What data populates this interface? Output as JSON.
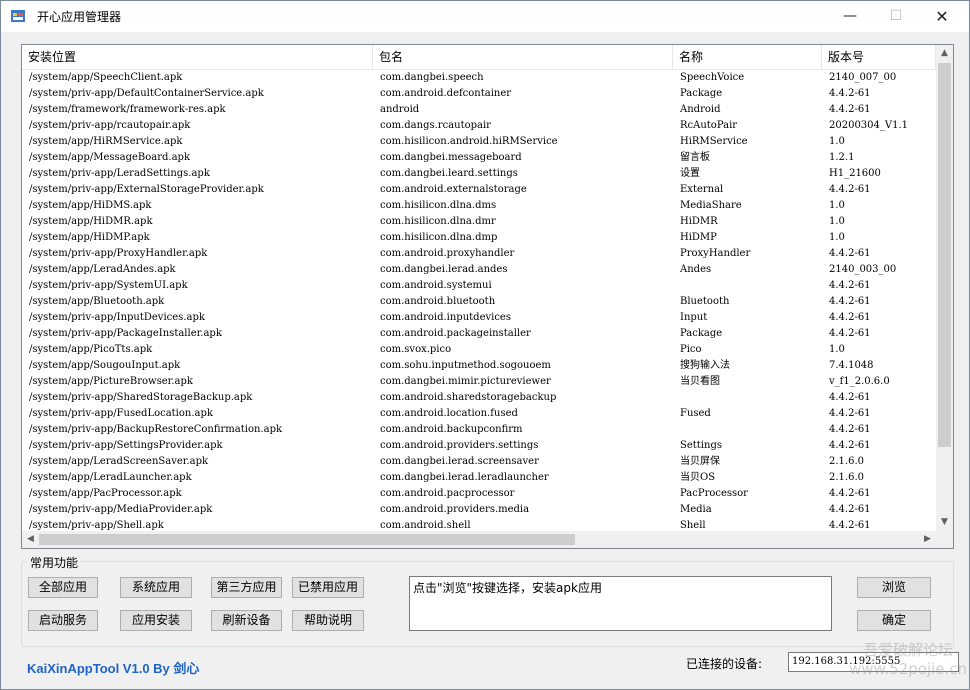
{
  "window": {
    "title": "开心应用管理器",
    "minimize": "—",
    "maximize": "☐",
    "close": "✕"
  },
  "columns": [
    "安装位置",
    "包名",
    "名称",
    "版本号"
  ],
  "rows": [
    [
      "/system/app/SpeechClient.apk",
      "com.dangbei.speech",
      "SpeechVoice",
      "2140_007_00"
    ],
    [
      "/system/priv-app/DefaultContainerService.apk",
      "com.android.defcontainer",
      "Package",
      "4.4.2-61"
    ],
    [
      "/system/framework/framework-res.apk",
      "android",
      "Android",
      "4.4.2-61"
    ],
    [
      "/system/priv-app/rcautopair.apk",
      "com.dangs.rcautopair",
      "RcAutoPair",
      "20200304_V1.1"
    ],
    [
      "/system/app/HiRMService.apk",
      "com.hisilicon.android.hiRMService",
      "HiRMService",
      "1.0"
    ],
    [
      "/system/app/MessageBoard.apk",
      "com.dangbei.messageboard",
      "留言板",
      "1.2.1"
    ],
    [
      "/system/priv-app/LeradSettings.apk",
      "com.dangbei.leard.settings",
      "设置",
      "H1_21600"
    ],
    [
      "/system/priv-app/ExternalStorageProvider.apk",
      "com.android.externalstorage",
      "External",
      "4.4.2-61"
    ],
    [
      "/system/app/HiDMS.apk",
      "com.hisilicon.dlna.dms",
      "MediaShare",
      "1.0"
    ],
    [
      "/system/app/HiDMR.apk",
      "com.hisilicon.dlna.dmr",
      "HiDMR",
      "1.0"
    ],
    [
      "/system/app/HiDMP.apk",
      "com.hisilicon.dlna.dmp",
      "HiDMP",
      "1.0"
    ],
    [
      "/system/priv-app/ProxyHandler.apk",
      "com.android.proxyhandler",
      "ProxyHandler",
      "4.4.2-61"
    ],
    [
      "/system/app/LeradAndes.apk",
      "com.dangbei.lerad.andes",
      "Andes",
      "2140_003_00"
    ],
    [
      "/system/priv-app/SystemUI.apk",
      "com.android.systemui",
      "",
      "4.4.2-61"
    ],
    [
      "/system/app/Bluetooth.apk",
      "com.android.bluetooth",
      "Bluetooth",
      "4.4.2-61"
    ],
    [
      "/system/priv-app/InputDevices.apk",
      "com.android.inputdevices",
      "Input",
      "4.4.2-61"
    ],
    [
      "/system/priv-app/PackageInstaller.apk",
      "com.android.packageinstaller",
      "Package",
      "4.4.2-61"
    ],
    [
      "/system/app/PicoTts.apk",
      "com.svox.pico",
      "Pico",
      "1.0"
    ],
    [
      "/system/app/SougouInput.apk",
      "com.sohu.inputmethod.sogouoem",
      "搜狗输入法",
      "7.4.1048"
    ],
    [
      "/system/app/PictureBrowser.apk",
      "com.dangbei.mimir.pictureviewer",
      "当贝看图",
      "v_f1_2.0.6.0"
    ],
    [
      "/system/priv-app/SharedStorageBackup.apk",
      "com.android.sharedstoragebackup",
      "",
      "4.4.2-61"
    ],
    [
      "/system/priv-app/FusedLocation.apk",
      "com.android.location.fused",
      "Fused",
      "4.4.2-61"
    ],
    [
      "/system/priv-app/BackupRestoreConfirmation.apk",
      "com.android.backupconfirm",
      "",
      "4.4.2-61"
    ],
    [
      "/system/priv-app/SettingsProvider.apk",
      "com.android.providers.settings",
      "Settings",
      "4.4.2-61"
    ],
    [
      "/system/app/LeradScreenSaver.apk",
      "com.dangbei.lerad.screensaver",
      "当贝屏保",
      "2.1.6.0"
    ],
    [
      "/system/app/LeradLauncher.apk",
      "com.dangbei.lerad.leradlauncher",
      "当贝OS",
      "2.1.6.0"
    ],
    [
      "/system/app/PacProcessor.apk",
      "com.android.pacprocessor",
      "PacProcessor",
      "4.4.2-61"
    ],
    [
      "/system/priv-app/MediaProvider.apk",
      "com.android.providers.media",
      "Media",
      "4.4.2-61"
    ],
    [
      "/system/priv-app/Shell.apk",
      "com.android.shell",
      "Shell",
      "4.4.2-61"
    ]
  ],
  "group": {
    "label": "常用功能",
    "btn_all": "全部应用",
    "btn_system": "系统应用",
    "btn_third": "第三方应用",
    "btn_disabled": "已禁用应用",
    "btn_service": "启动服务",
    "btn_install": "应用安装",
    "btn_refresh": "刷新设备",
    "btn_help": "帮助说明",
    "message": "点击\"浏览\"按键选择，安装apk应用",
    "btn_browse": "浏览",
    "btn_ok": "确定"
  },
  "footer": {
    "brand": "KaiXinAppTool V1.0 By 剑心",
    "device_label": "已连接的设备:",
    "device_value": "192.168.31.192:5555"
  },
  "watermark": {
    "line1": "吾爱破解论坛",
    "line2": "www.52pojie.cn"
  }
}
